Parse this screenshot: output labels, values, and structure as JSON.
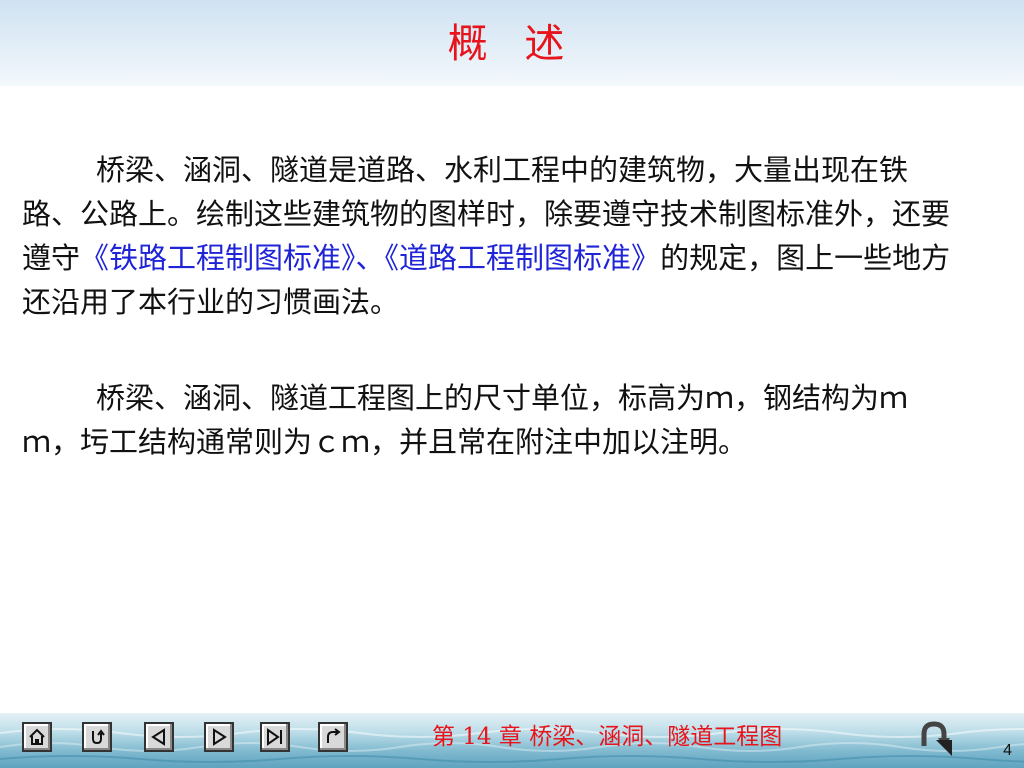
{
  "slide": {
    "title": "概 述",
    "paragraph1": {
      "part1": "桥梁、涵洞、隧道是道路、水利工程中的建筑物，大量出现在铁路、公路上。绘制这些建筑物的图样时，除要遵守技术制图标准外，还要遵守",
      "link1": "《铁路工程制图标准》",
      "sep": "、",
      "link2": "《道路工程制图标准》",
      "part2": "的规定，图上一些地方还沿用了本行业的习惯画法。"
    },
    "paragraph2": "桥梁、涵洞、隧道工程图上的尺寸单位，标高为ｍ，钢结构为ｍｍ，圬工结构通常则为ｃｍ，并且常在附注中加以注明。",
    "footer": {
      "chapter": "第 14 章  桥梁、涵洞、隧道工程图",
      "page_number": "4"
    },
    "nav_icons": [
      "home-icon",
      "return-u-icon",
      "prev-icon",
      "next-icon",
      "last-icon",
      "back-arrow-icon",
      "return-to-icon"
    ],
    "colors": {
      "title": "#e8141b",
      "link": "#1f24d6",
      "chapter": "#e8141b"
    }
  }
}
